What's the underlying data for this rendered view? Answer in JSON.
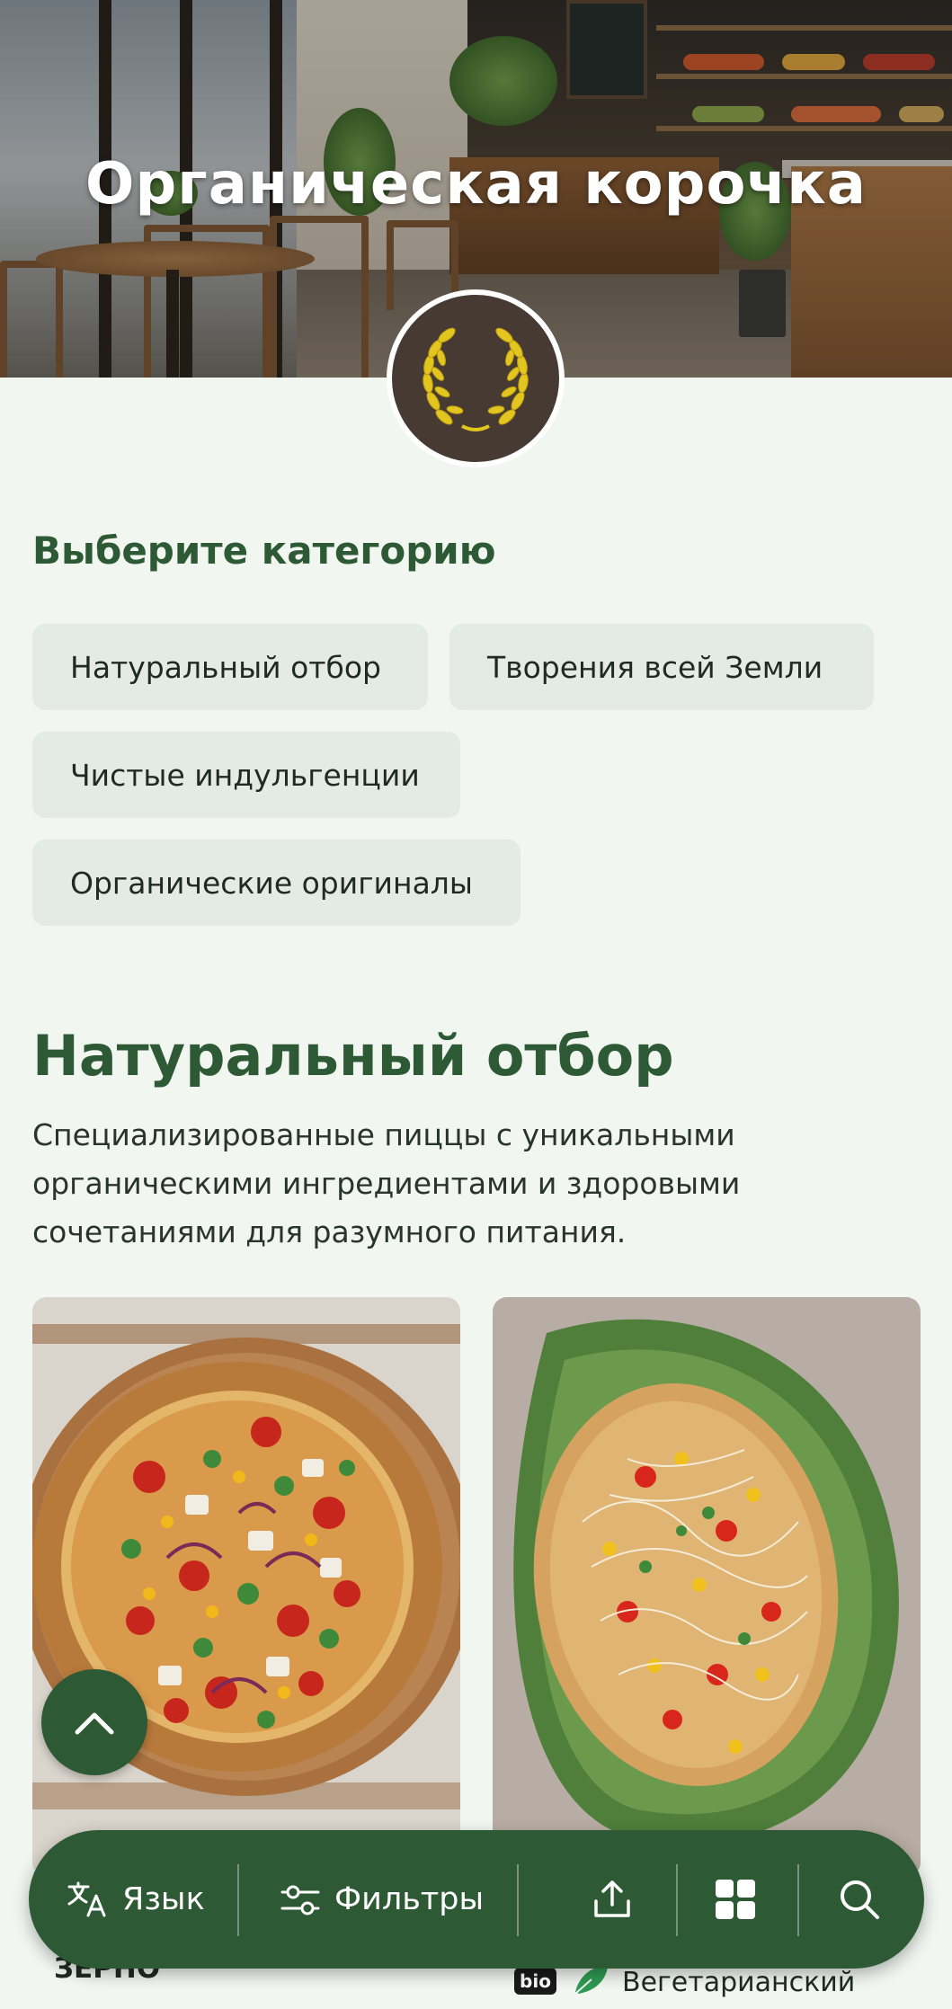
{
  "hero": {
    "title": "Органическая корочка",
    "logo_icon": "wheat-wreath-icon"
  },
  "categories": {
    "heading": "Выберите категорию",
    "items": [
      {
        "label": "Натуральный отбор"
      },
      {
        "label": "Творения всей Земли"
      },
      {
        "label": "Чистые индульгенции"
      },
      {
        "label": "Органические оригиналы"
      }
    ]
  },
  "section": {
    "title": "Натуральный отбор",
    "description": "Специализированные пиццы с уникальными органическими ингредиентами и здоровыми сочетаниями для разумного питания."
  },
  "peek": {
    "left_name": "ЗЕРНО",
    "badge": "bio",
    "diet_label": "Вегетарианский"
  },
  "toolbar": {
    "language_label": "Язык",
    "filters_label": "Фильтры"
  },
  "colors": {
    "accent": "#2d5a35",
    "background": "#f1f6f1",
    "chip": "#e4ebe5"
  }
}
